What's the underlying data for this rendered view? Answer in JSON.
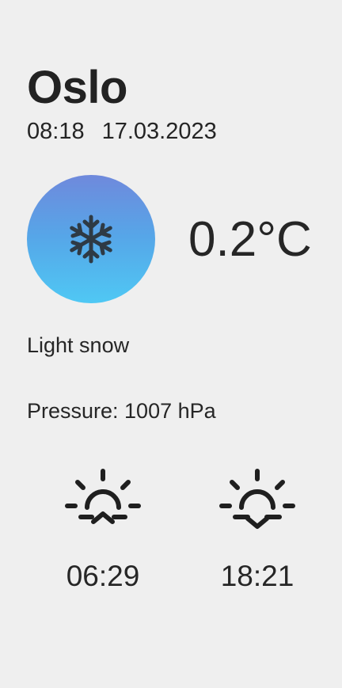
{
  "location": {
    "city": "Oslo",
    "time": "08:18",
    "date": "17.03.2023"
  },
  "current": {
    "icon": "snowflake-icon",
    "temperature": "0.2°C",
    "description": "Light snow",
    "pressure": "Pressure: 1007 hPa"
  },
  "sun": {
    "sunrise_icon": "sunrise-icon",
    "sunrise": "06:29",
    "sunset_icon": "sunset-icon",
    "sunset": "18:21"
  },
  "colors": {
    "background": "#efefef",
    "text": "#222222",
    "gradient_top": "#6f89dc",
    "gradient_bottom": "#4fc8f4",
    "icon": "#2e3a45"
  }
}
